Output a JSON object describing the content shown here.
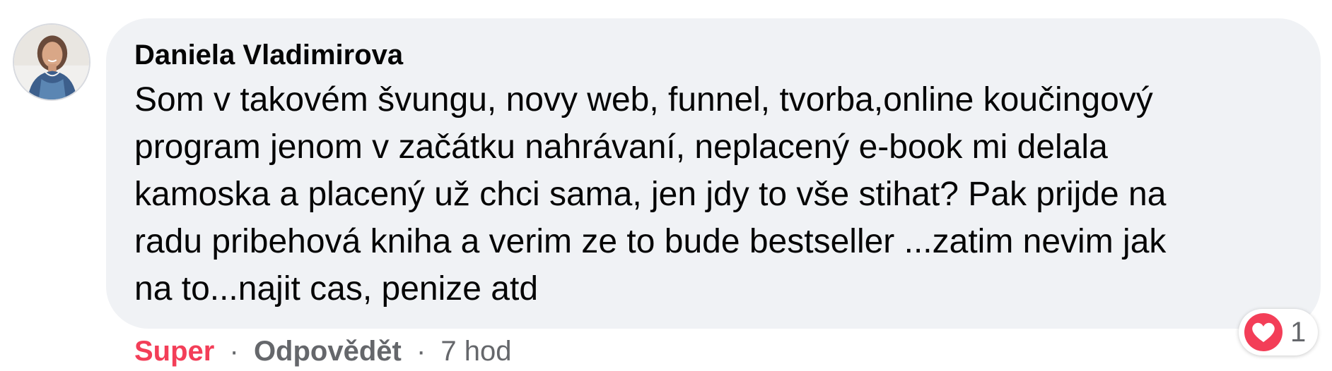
{
  "comment": {
    "author": "Daniela Vladimirova",
    "text": "Som v takovém švungu, novy web, funnel, tvorba,online koučingový\nprogram jenom v začátku nahrávaní, neplacený e-book mi delala\nkamoska a placený už chci sama, jen jdy to vše stihat? Pak prijde na\nradu pribehová kniha a verim ze to bude bestseller ...zatim nevim jak\nna to...najit cas, penize atd",
    "avatar_icon": "user-avatar-photo"
  },
  "reactions": {
    "icon": "heart-icon",
    "count": "1"
  },
  "actions": {
    "reaction_label": "Super",
    "separator": "·",
    "reply_label": "Odpovědět",
    "timestamp": "7 hod"
  },
  "colors": {
    "bubble_background": "#f0f2f5",
    "reaction_accent": "#f33e58",
    "secondary_text": "#65676b",
    "primary_text": "#050505"
  }
}
